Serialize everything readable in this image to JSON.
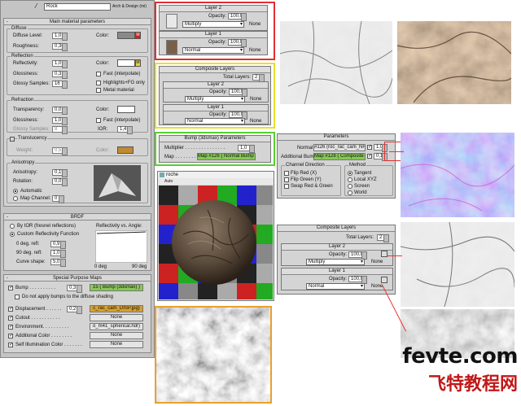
{
  "header": {
    "material_name": "Rock",
    "material_type": "Arch & Design (mi)"
  },
  "main_params": {
    "title": "Main material parameters",
    "diffuse": {
      "title": "Diffuse",
      "level_label": "Diffuse Level:",
      "level": "1,0",
      "color_label": "Color:",
      "m": "M",
      "rough_label": "Roughness:",
      "rough": "0,36"
    },
    "reflection": {
      "title": "Reflection",
      "refl_label": "Reflectivity:",
      "refl": "1,0",
      "color_label": "Color:",
      "gloss_label": "Glossiness:",
      "gloss": "0,3",
      "samples_label": "Glossy Samples:",
      "samples": "16",
      "fast": "Fast (interpolate)",
      "highlights": "Highlights+FG only",
      "metal": "Metal material",
      "m": "M"
    },
    "refraction": {
      "title": "Refraction",
      "trans_label": "Transparency:",
      "trans": "0,0",
      "color_label": "Color:",
      "gloss_label": "Glossiness:",
      "gloss": "1,0",
      "samples_label": "Glossy Samples:",
      "samples": "8",
      "fast": "Fast (interpolate)",
      "ior_label": "IOR:",
      "ior": "1,4",
      "translucency": "Translucency",
      "weight_label": "Weight:",
      "weight": "0,5",
      "color2_label": "Color:"
    },
    "aniso": {
      "title": "Anisotropy",
      "aniso_label": "Anisotropy:",
      "aniso": "0,15",
      "rot_label": "Rotation:",
      "rot": "0,0",
      "auto": "Automatic",
      "mapchan": "Map Channel:",
      "mapchan_val": "0"
    }
  },
  "brdf": {
    "title": "BRDF",
    "by_ior": "By IOR (fresnel reflections)",
    "custom": "Custom Reflectivity Function",
    "refl_vs_angle": "Reflectivity vs. Angle:",
    "deg0_label": "0 deg. refl:",
    "deg0": "0,9",
    "deg90_label": "90 deg. refl:",
    "deg90": "1,0",
    "curve_label": "Curve shape:",
    "curve": "5,0",
    "axis_left": "0 deg",
    "axis_right": "90 deg"
  },
  "special": {
    "title": "Special Purpose Maps",
    "bump_label": "Bump . . . . . . . . . .",
    "bump_val": "0,3",
    "bump_map": "15 ( Bump (3dsmax) )",
    "no_apply": "Do not apply bumps to the diffuse shading",
    "disp_label": "Displacement . . . . . .",
    "disp_val": "0,2",
    "disp_map": "c_rac_cam_DISP.jpg)",
    "cutout_label": "Cutout . . . . . . . . . . .",
    "cutout_map": "None",
    "env_label": "Environment. . . . . . . . . .",
    "env_map": "o_m41_spherical.hdr)",
    "addcol_label": "Additional Color . . . . . . . .",
    "addcol_map": "None",
    "selfillum_label": "Self Illumination Color . . . . . . .",
    "selfillum_map": "None"
  },
  "top_layers": {
    "layer2": "Layer 2",
    "layer1": "Layer 1",
    "opacity_label": "Opacity:",
    "opacity": "100,0",
    "blend2": "Multiply",
    "blend1": "Normal",
    "none": "None"
  },
  "composite": {
    "title": "Composite Layers",
    "total_label": "Total Layers:",
    "total": "2",
    "layer2": "Layer 2",
    "layer1": "Layer 1",
    "opacity_label": "Opacity:",
    "opacity": "100,0",
    "blend2": "Multiply",
    "blend1": "Normal",
    "none": "None"
  },
  "bump_params": {
    "title": "Bump (3dsmax) Parameters",
    "mult_label": "Multiplier . . . . . . . . . . . . . . .",
    "mult": "1,0",
    "map_label": "Map . . . . . . . .",
    "map": "Map #126 ( Normal Bump )"
  },
  "normal_params": {
    "title": "Parameters",
    "normal_label": "Normal:",
    "normal_map": "#126 (roc_rac_cam_NRM.jpg)",
    "normal_val": "1,0",
    "addbump_label": "Additional Bump:",
    "addbump_map": "Map #128 ( Composite )",
    "addbump_val": "0,1",
    "chan_title": "Channel Direction",
    "flipred": "Flip Red (X)",
    "flipgreen": "Flip Green (Y)",
    "swap": "Swap Red & Green",
    "method_title": "Method",
    "tangent": "Tangent",
    "localxyz": "Local XYZ",
    "screen": "Screen",
    "world": "World"
  },
  "composite2": {
    "title": "Composite Layers",
    "total_label": "Total Layers:",
    "total": "2",
    "layer2": "Layer 2",
    "layer1": "Layer 1",
    "opacity_label": "Opacity:",
    "opacity": "100,0",
    "blend2": "Multiply",
    "blend1": "Normal",
    "none": "None"
  },
  "preview": {
    "title": "roche",
    "auto": "Auto",
    "update": "Update"
  },
  "watermark": {
    "site": "fevte.com",
    "cn": "飞特教程网"
  },
  "colors": {
    "red_frame": "#e03030",
    "yellow_frame": "#e8e030",
    "green_frame": "#58d030",
    "orange_frame": "#e8a030",
    "map_green": "#88c858",
    "map_orange": "#d8a030",
    "diffuse_swatch": "#8a8a8a",
    "refl_swatch": "#ffffff",
    "trans_swatch": "#ffffff",
    "transl_swatch": "#c08a30"
  }
}
